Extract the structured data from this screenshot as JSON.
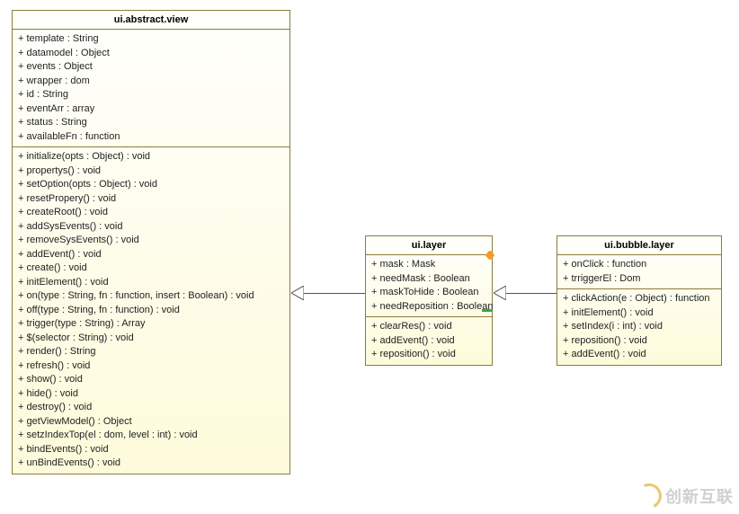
{
  "classA": {
    "name": "ui.abstract.view",
    "attributes": [
      "+ template : String",
      "+ datamodel : Object",
      "+ events : Object",
      "+ wrapper : dom",
      "+ id : String",
      "+ eventArr : array",
      "+ status : String",
      "+ availableFn : function"
    ],
    "methods": [
      "+ initialize(opts : Object) : void",
      "+ propertys() : void",
      "+ setOption(opts : Object) : void",
      "+ resetPropery() : void",
      "+ createRoot() : void",
      "+ addSysEvents() : void",
      "+ removeSysEvents() : void",
      "+ addEvent() : void",
      "+ create() : void",
      "+ initElement() : void",
      "+ on(type : String, fn : function, insert : Boolean) : void",
      "+ off(type : String, fn : function) : void",
      "+ trigger(type : String) : Array",
      "+ $(selector : String) : void",
      "+ render() : String",
      "+ refresh() : void",
      "+ show() : void",
      "+ hide() : void",
      "+ destroy() : void",
      "+ getViewModel() : Object",
      "+ setzIndexTop(el : dom, level : int) : void",
      "+ bindEvents() : void",
      "+ unBindEvents() : void"
    ]
  },
  "classB": {
    "name": "ui.layer",
    "attributes": [
      "+ mask : Mask",
      "+ needMask : Boolean",
      "+ maskToHide : Boolean",
      "+ needReposition : Boolean"
    ],
    "methods": [
      "+ clearRes() : void",
      "+ addEvent() : void",
      "+ reposition() : void"
    ]
  },
  "classC": {
    "name": "ui.bubble.layer",
    "attributes": [
      "+ onClick : function",
      "+ trriggerEl : Dom"
    ],
    "methods": [
      "+ clickAction(e : Object) : function",
      "+ initElement() : void",
      "+ setIndex(i : int) : void",
      "+ reposition() : void",
      "+ addEvent() : void"
    ]
  },
  "watermark": "创新互联"
}
